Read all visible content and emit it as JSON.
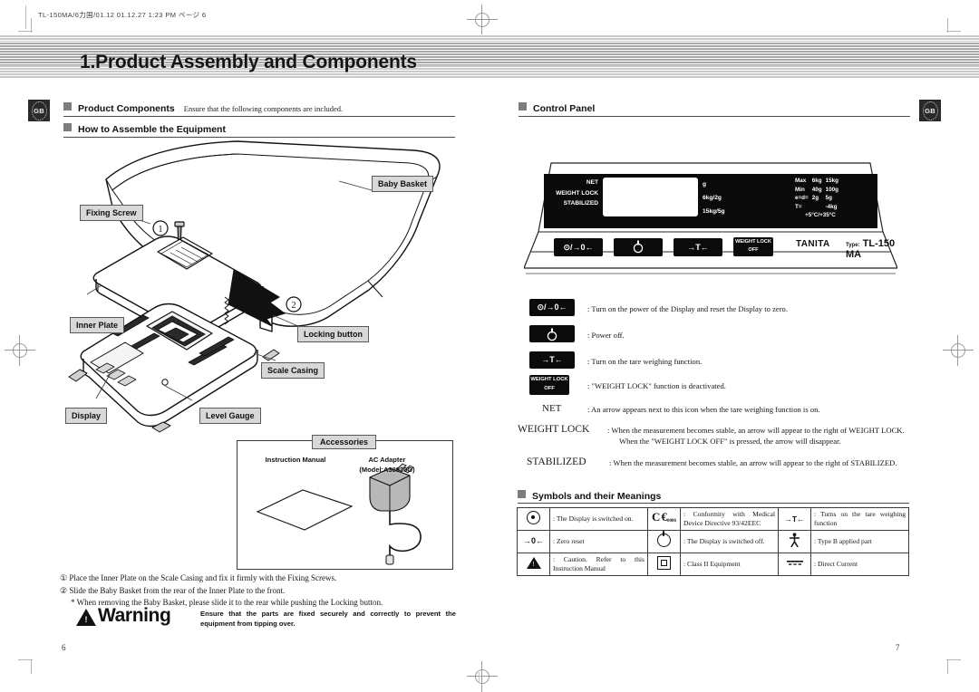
{
  "slug": "TL-150MA/6力国/01.12  01.12.27 1:23 PM  ページ 6",
  "title": "1.Product Assembly and Components",
  "tabs": {
    "left_label": "GB",
    "right_label": "GB"
  },
  "left_page": {
    "sections": [
      {
        "heading": "Product Components",
        "sub": "Ensure that the following components are included."
      },
      {
        "heading": "How to Assemble the Equipment",
        "sub": ""
      }
    ],
    "diagram_labels": [
      {
        "name": "baby-basket",
        "text": "Baby Basket"
      },
      {
        "name": "fixing-screw",
        "text": "Fixing Screw"
      },
      {
        "name": "inner-plate",
        "text": "Inner Plate"
      },
      {
        "name": "locking-button",
        "text": "Locking button"
      },
      {
        "name": "scale-casing",
        "text": "Scale Casing"
      },
      {
        "name": "display",
        "text": "Display"
      },
      {
        "name": "level-gauge",
        "text": "Level Gauge"
      }
    ],
    "callouts": [
      "1",
      "2"
    ],
    "accessories": {
      "title": "Accessories",
      "items": [
        {
          "label": "Instruction Manual",
          "sub": ""
        },
        {
          "label": "AC Adapter",
          "sub": "(Model:A30930G)"
        }
      ]
    },
    "steps": [
      "① Place the Inner Plate on the Scale Casing and fix it firmly with the Fixing Screws.",
      "② Slide the Baby Basket from the rear of the Inner Plate to the front.",
      "* When removing the Baby Basket, please slide it to the rear while pushing the Locking button."
    ],
    "warning": {
      "word": "Warning",
      "symbol": "!",
      "text": "Ensure that the parts are fixed securely and correctly to prevent the equipment from tipping over."
    },
    "page_number": "6"
  },
  "right_page": {
    "sections": [
      {
        "heading": "Control Panel"
      },
      {
        "heading": "Symbols and their Meanings"
      }
    ],
    "control_panel": {
      "lcd_labels": [
        "NET",
        "WEIGHT LOCK",
        "STABILIZED"
      ],
      "units": [
        "g",
        "6kg/2g",
        "15kg/5g"
      ],
      "specs": [
        {
          "label": "Max",
          "col1": "6kg",
          "col2": "15kg"
        },
        {
          "label": "Min",
          "col1": "40g",
          "col2": "100g"
        },
        {
          "label": "e=d=",
          "col1": "2g",
          "col2": "5g"
        },
        {
          "label": "T=",
          "col1": "",
          "col2": "-4kg"
        }
      ],
      "temperature": "+5°C/+35°C",
      "buttons": [
        {
          "name": "zero-power-on-button",
          "line1": "⊙/→0←",
          "line2": ""
        },
        {
          "name": "power-off-button",
          "line1": "",
          "line2": ""
        },
        {
          "name": "tare-button",
          "line1": "→T←",
          "line2": ""
        },
        {
          "name": "weight-lock-off-button",
          "line1": "WEIGHT LOCK",
          "line2": "OFF"
        }
      ],
      "brand": "TANITA",
      "type_prefix": "Type:",
      "type_value": "TL-150 MA"
    },
    "key_legend": [
      {
        "name": "zero-power-on-key",
        "line1": "⊙/→0←",
        "line2": "",
        "desc": ": Turn on the power of the Display and reset the Display to zero."
      },
      {
        "name": "power-off-key",
        "line1": "",
        "line2": "",
        "desc": ": Power off."
      },
      {
        "name": "tare-key",
        "line1": "→T←",
        "line2": "",
        "desc": ": Turn on the tare weighing function."
      },
      {
        "name": "weight-lock-off-key",
        "line1": "WEIGHT LOCK",
        "line2": "OFF",
        "desc": ": \"WEIGHT LOCK\" function is deactivated."
      }
    ],
    "indicator_notes": [
      {
        "term": "NET",
        "desc": ": An arrow appears next to this icon when the tare weighing function is on.",
        "desc2": ""
      },
      {
        "term": "WEIGHT LOCK",
        "desc": ": When the measurement becomes stable, an arrow will appear to the right of WEIGHT LOCK.",
        "desc2": "When the \"WEIGHT LOCK OFF\" is pressed, the arrow will disappear."
      },
      {
        "term": "STABILIZED",
        "desc": ": When the measurement becomes stable, an arrow will appear to the right of STABILIZED.",
        "desc2": ""
      }
    ],
    "symbols_table": [
      [
        {
          "icon": "dot-circle-icon",
          "text": ": The Display is switched on."
        },
        {
          "icon": "ce-mark-icon",
          "ce_num": "0086",
          "text": ": Conformity with Medical Device Directive 93/42EEC"
        },
        {
          "icon": "tare-arrow-icon",
          "glyph": "→T←",
          "text": ": Turns on the tare weighing function"
        }
      ],
      [
        {
          "icon": "zero-reset-icon",
          "glyph": "→0←",
          "text": ": Zero reset"
        },
        {
          "icon": "power-off-icon",
          "text": ": The Display is switched off."
        },
        {
          "icon": "type-b-person-icon",
          "glyph": "ᾜd",
          "text": ": Type B applied part"
        }
      ],
      [
        {
          "icon": "caution-triangle-icon",
          "text": ": Caution. Refer to this Instruction Manual"
        },
        {
          "icon": "class-two-square-icon",
          "text": ": Class II Equipment"
        },
        {
          "icon": "direct-current-icon",
          "glyph": "⎓",
          "text": ": Direct Current"
        }
      ]
    ],
    "page_number": "7"
  }
}
